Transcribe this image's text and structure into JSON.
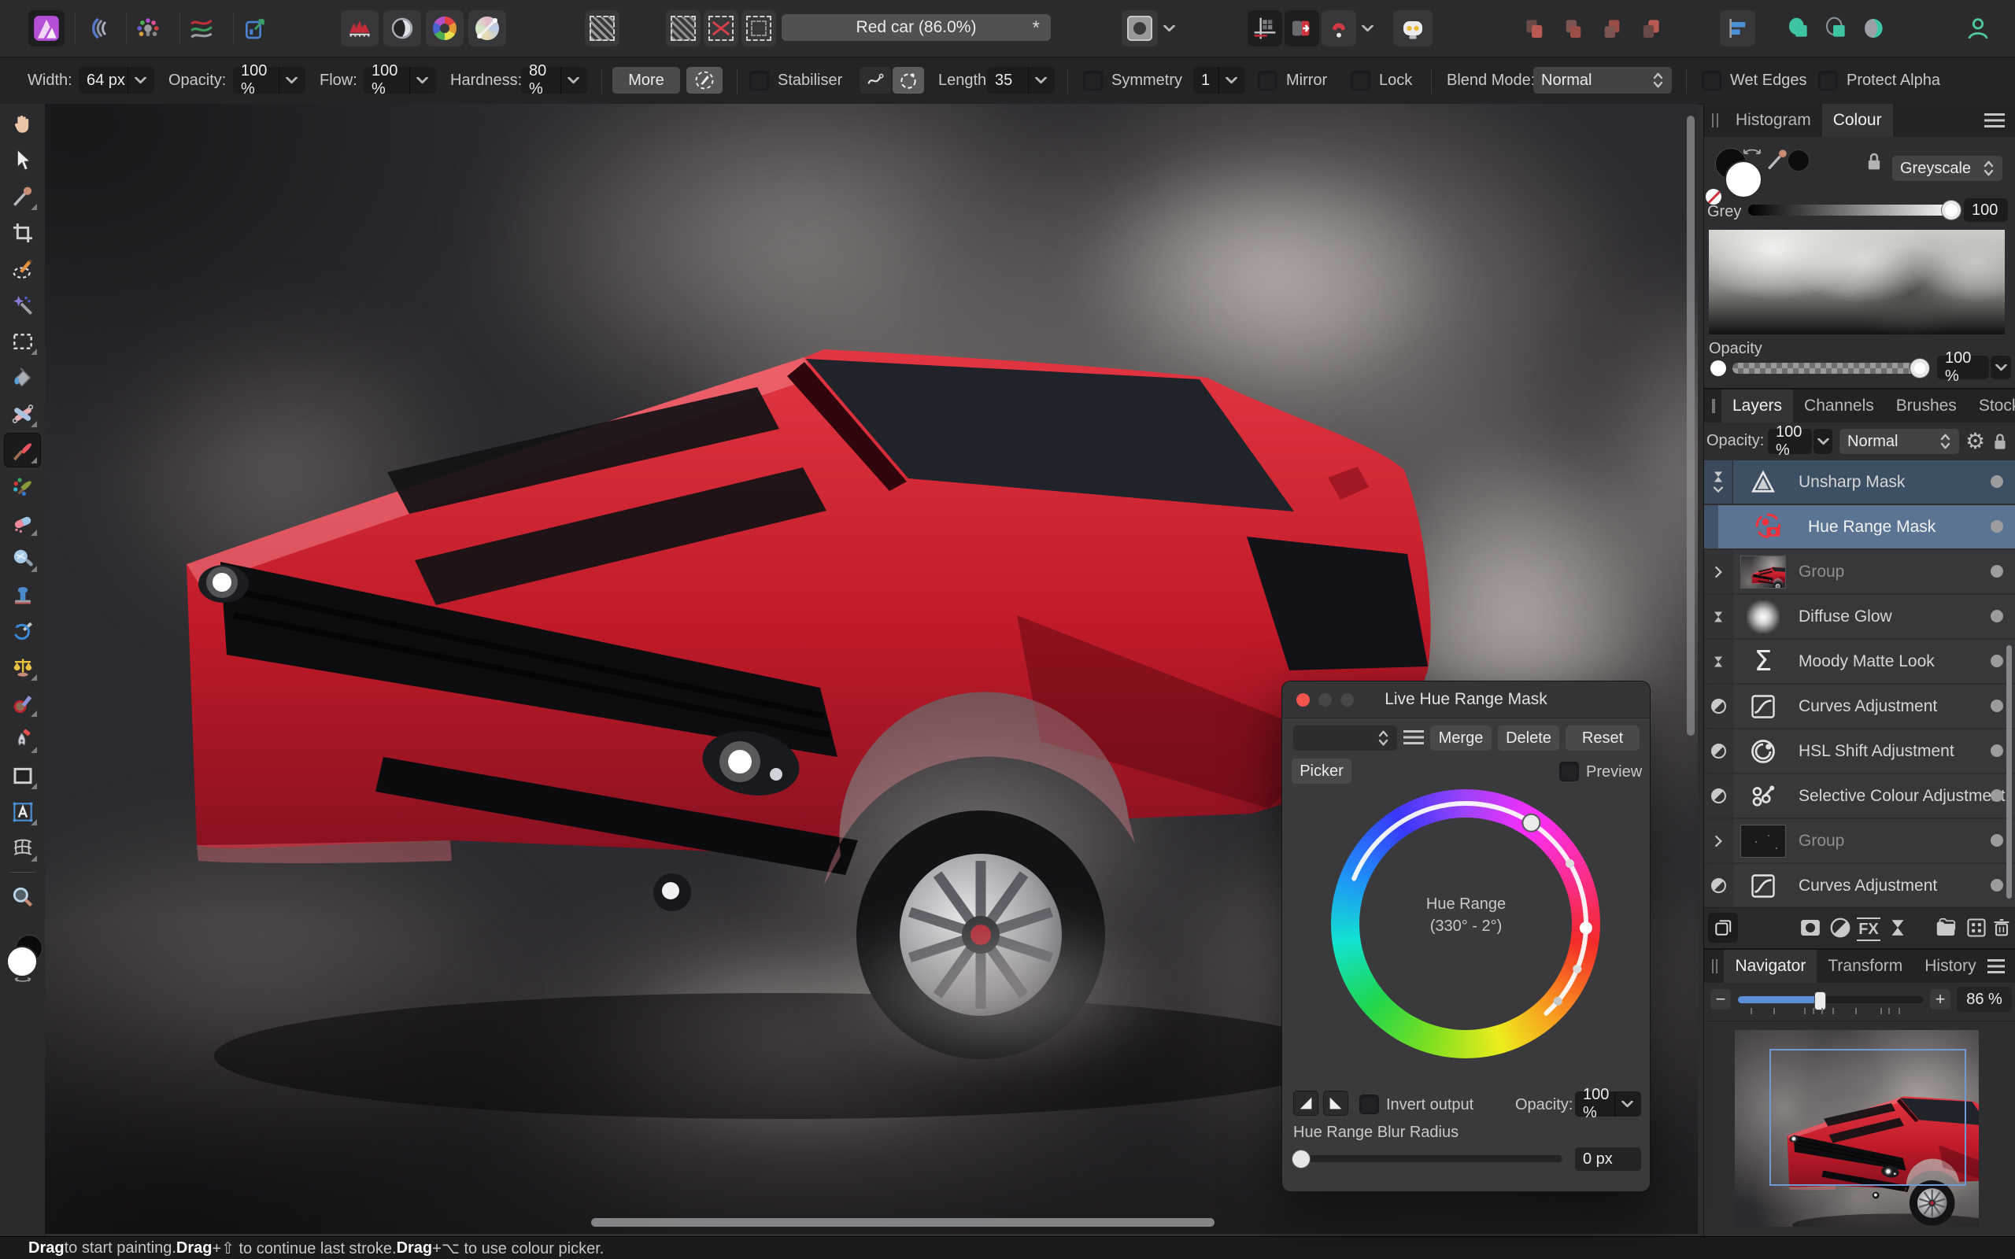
{
  "window": {
    "title": "Red car (86.0%)",
    "star": "*"
  },
  "ctx": {
    "width_label": "Width:",
    "width_value": "64 px",
    "opacity_label": "Opacity:",
    "opacity_value": "100 %",
    "flow_label": "Flow:",
    "flow_value": "100 %",
    "hardness_label": "Hardness:",
    "hardness_value": "80 %",
    "more": "More",
    "stabiliser": "Stabiliser",
    "length_label": "Length",
    "length_value": "35",
    "symmetry": "Symmetry",
    "symmetry_value": "1",
    "mirror": "Mirror",
    "lock": "Lock",
    "blend_label": "Blend Mode:",
    "blend_value": "Normal",
    "wet_edges": "Wet Edges",
    "protect_alpha": "Protect Alpha"
  },
  "colour": {
    "tab_histogram": "Histogram",
    "tab_colour": "Colour",
    "model": "Greyscale",
    "grey_label": "Grey",
    "grey_value": "100",
    "opacity_label": "Opacity",
    "opacity_value": "100 %"
  },
  "layers": {
    "tab_layers": "Layers",
    "tab_channels": "Channels",
    "tab_brushes": "Brushes",
    "tab_stock": "Stock",
    "opacity_label": "Opacity:",
    "opacity_value": "100 %",
    "blend": "Normal",
    "rows": [
      {
        "name": "Unsharp Mask"
      },
      {
        "name": "Hue Range Mask"
      },
      {
        "name": "Group"
      },
      {
        "name": "Diffuse Glow"
      },
      {
        "name": "Moody Matte Look"
      },
      {
        "name": "Curves Adjustment"
      },
      {
        "name": "HSL Shift Adjustment"
      },
      {
        "name": "Selective Colour Adjustment"
      },
      {
        "name": "Group"
      },
      {
        "name": "Curves Adjustment"
      }
    ]
  },
  "nav": {
    "tab_navigator": "Navigator",
    "tab_transform": "Transform",
    "tab_history": "History",
    "zoom": "86 %"
  },
  "dlg": {
    "title": "Live Hue Range Mask",
    "merge": "Merge",
    "delete": "Delete",
    "reset": "Reset",
    "picker": "Picker",
    "preview": "Preview",
    "hue1": "Hue Range",
    "hue2": "(330° - 2°)",
    "invert": "Invert output",
    "opacity_label": "Opacity:",
    "opacity_value": "100 %",
    "blur_label": "Hue Range Blur Radius",
    "blur_value": "0 px"
  },
  "status": {
    "b1": "Drag",
    "t1": " to start painting. ",
    "b2": "Drag",
    "t2": "+⇧ to continue last stroke. ",
    "b3": "Drag",
    "t3": "+⌥ to use colour picker."
  },
  "colors": {
    "accent_blue": "#5b8fd6",
    "layer_selected": "#3d4f63",
    "layer_selected_child": "#5b7493",
    "red_accent": "#e8323c",
    "traffic_close": "#f0544c"
  },
  "icons": {
    "gear": "⚙",
    "shift_key": "⇧",
    "option_key": "⌥"
  }
}
